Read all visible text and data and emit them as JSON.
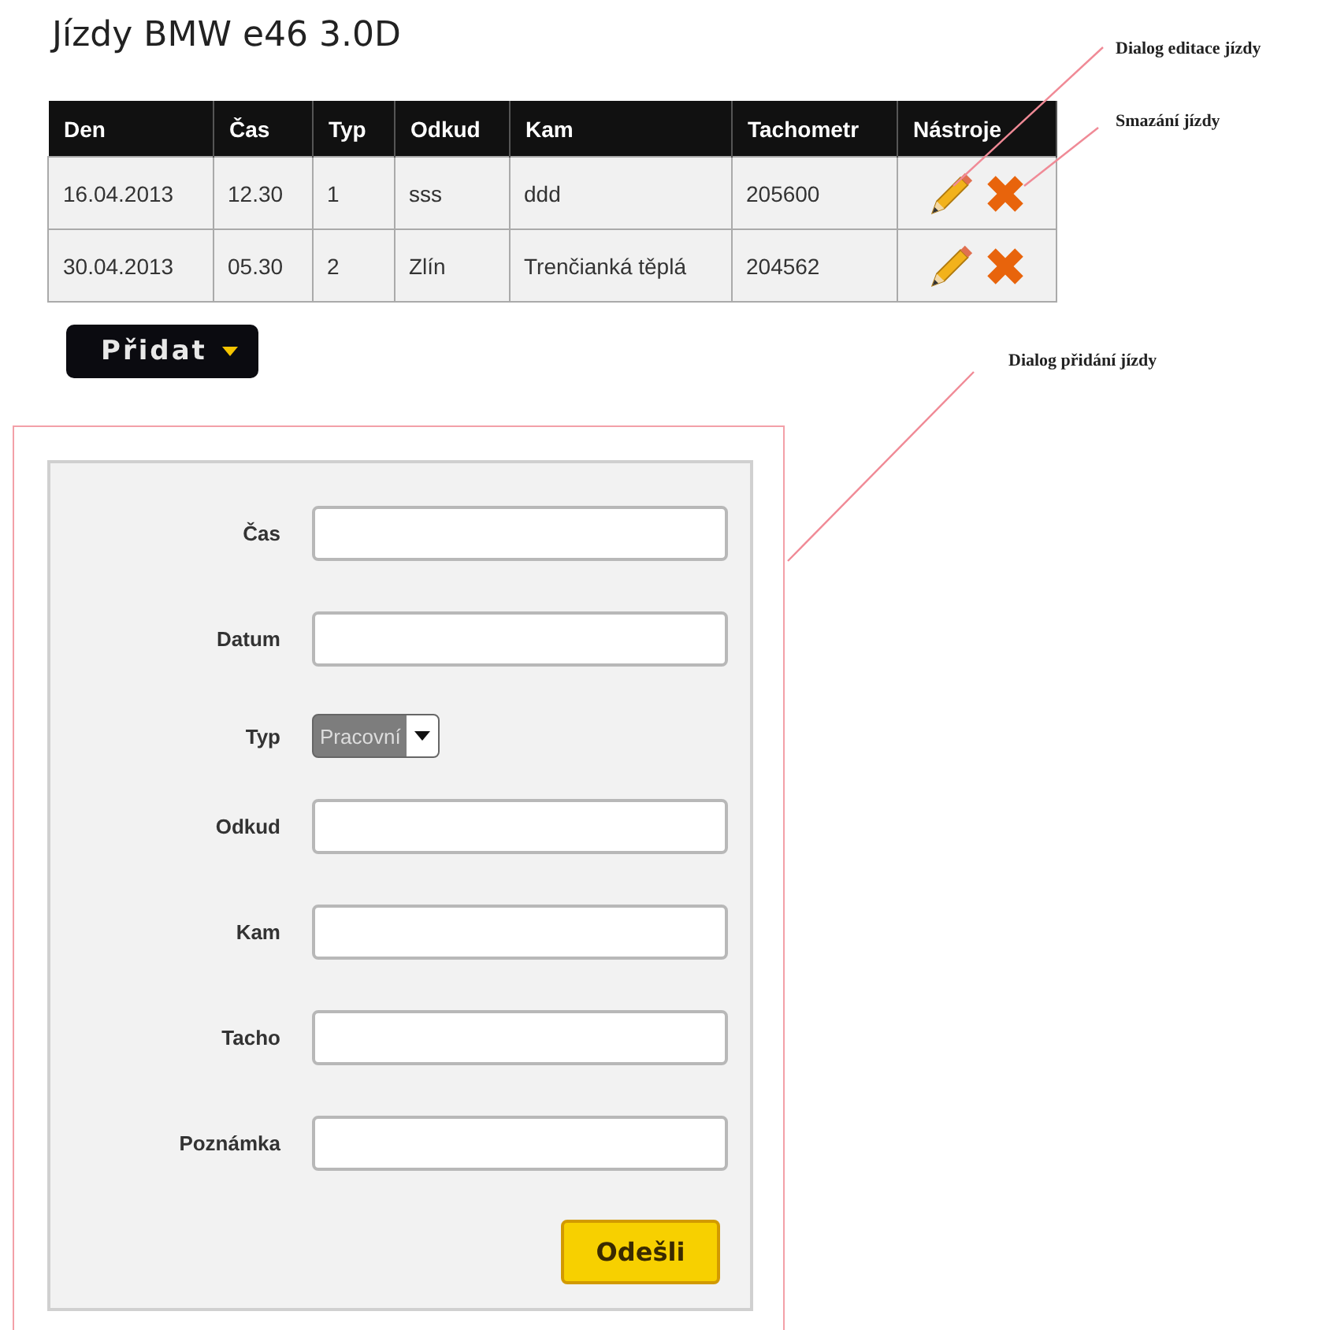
{
  "title": "Jízdy BMW e46 3.0D",
  "table": {
    "columns": [
      "Den",
      "Čas",
      "Typ",
      "Odkud",
      "Kam",
      "Tachometr",
      "Nástroje"
    ],
    "rows": [
      {
        "cells": [
          "16.04.2013",
          "12.30",
          "1",
          "sss",
          "ddd",
          "205600"
        ]
      },
      {
        "cells": [
          "30.04.2013",
          "05.30",
          "2",
          "Zlín",
          "Trenčianká těplá",
          "204562"
        ]
      }
    ]
  },
  "add_button": {
    "label": "Přidat"
  },
  "form": {
    "fields": [
      {
        "label": "Čas",
        "kind": "text"
      },
      {
        "label": "Datum",
        "kind": "text"
      },
      {
        "label": "Typ",
        "kind": "select",
        "value": "Pracovní"
      },
      {
        "label": "Odkud",
        "kind": "text"
      },
      {
        "label": "Kam",
        "kind": "text"
      },
      {
        "label": "Tacho",
        "kind": "text"
      },
      {
        "label": "Poznámka",
        "kind": "text"
      }
    ],
    "submit": "Odešli"
  },
  "annotations": [
    {
      "text": "Dialog editace jízdy"
    },
    {
      "text": "Smazání jízdy"
    },
    {
      "text": "Dialog přidání jízdy"
    }
  ]
}
